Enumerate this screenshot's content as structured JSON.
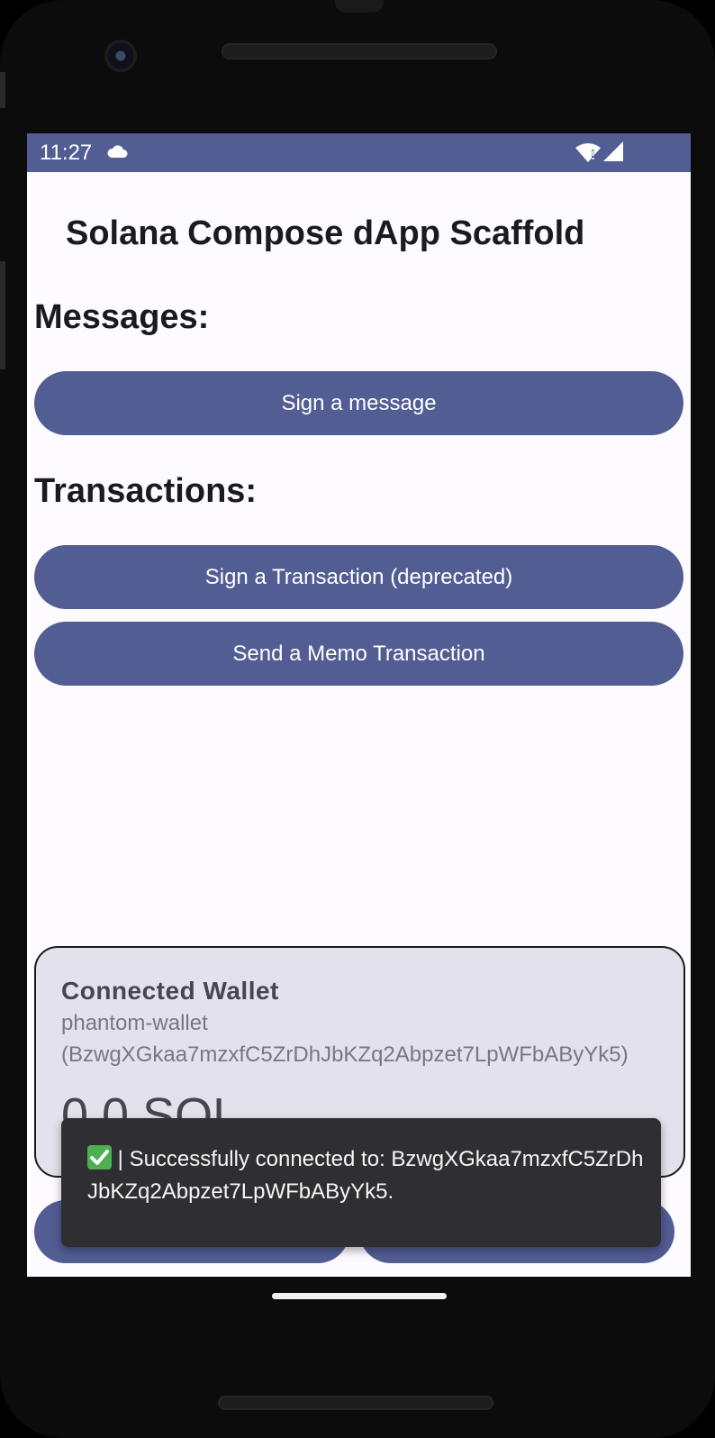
{
  "status_bar": {
    "time": "11:27",
    "icons": [
      "cloud-icon",
      "wifi-icon",
      "signal-icon"
    ]
  },
  "app": {
    "title": "Solana Compose dApp Scaffold"
  },
  "messages": {
    "heading": "Messages:",
    "sign_message_label": "Sign a message"
  },
  "transactions": {
    "heading": "Transactions:",
    "sign_transaction_label": "Sign a Transaction (deprecated)",
    "send_memo_label": "Send a Memo Transaction"
  },
  "wallet": {
    "heading": "Connected Wallet",
    "name": "phantom-wallet",
    "address": "(BzwgXGkaa7mzxfC5ZrDhJbKZq2Abpzet7LpWFbAByYk5)",
    "balance": "0.0 SOL"
  },
  "toast": {
    "icon": "check-icon",
    "message": "| Successfully connected to: BzwgXGkaa7mzxfC5ZrDhJbKZq2Abpzet7LpWFbAByYk5."
  },
  "colors": {
    "primary": "#525d94",
    "surface": "#fdfbff",
    "card": "#e3e2ec",
    "toast": "#2f2f33"
  }
}
